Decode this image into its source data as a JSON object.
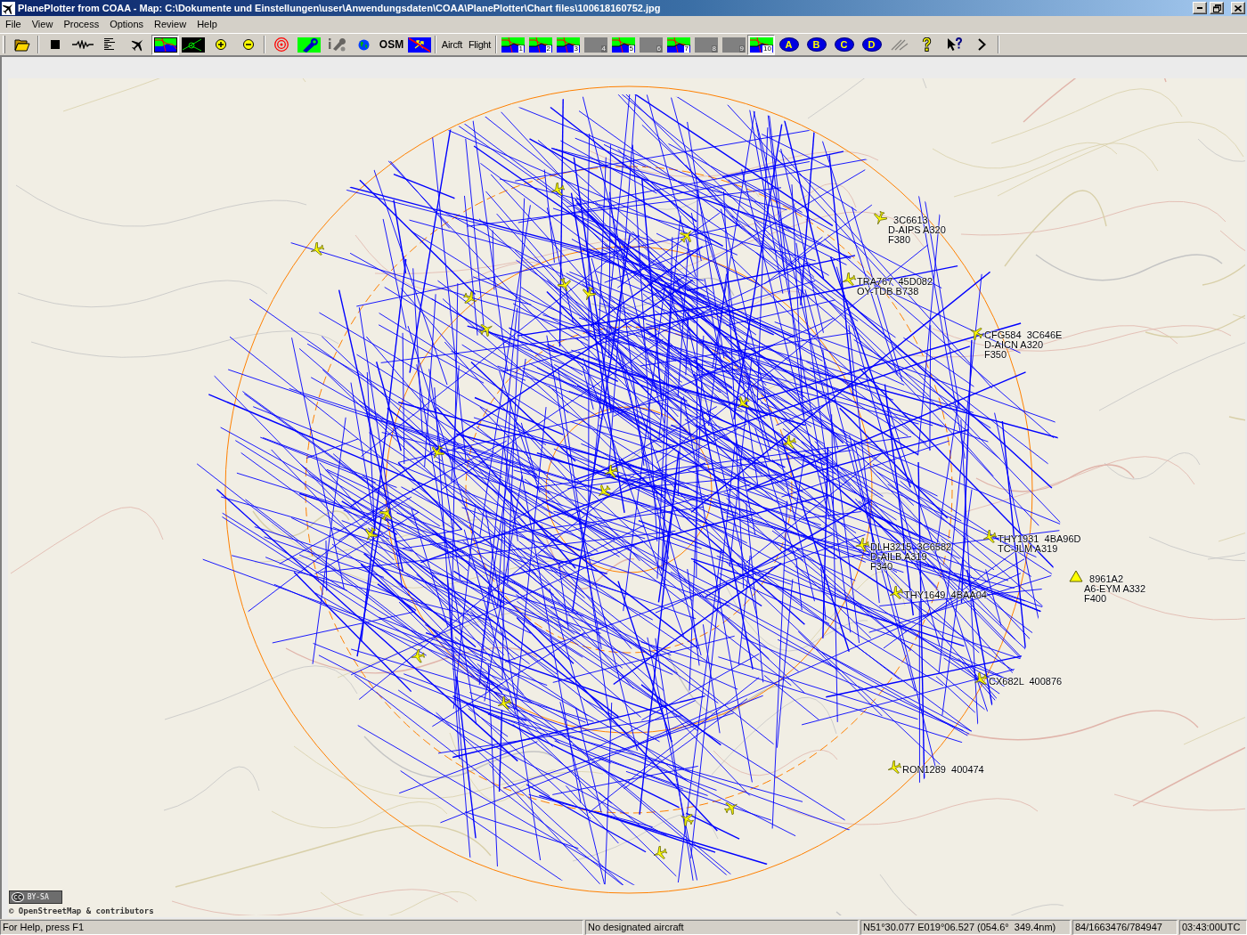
{
  "window": {
    "title": "PlanePlotter from COAA - Map: C:\\Dokumente und Einstellungen\\user\\Anwendungsdaten\\COAA\\PlanePlotter\\Chart files\\100618160752.jpg"
  },
  "menu": [
    "File",
    "View",
    "Process",
    "Options",
    "Review",
    "Help"
  ],
  "toolbar": [
    {
      "buttons": [
        {
          "kind": "open",
          "pressed": false,
          "disabled": false
        }
      ]
    },
    {
      "buttons": [
        {
          "kind": "stop",
          "pressed": false,
          "disabled": false
        },
        {
          "kind": "wave",
          "pressed": false,
          "disabled": false
        },
        {
          "kind": "list",
          "pressed": false,
          "disabled": false
        },
        {
          "kind": "plane",
          "pressed": false,
          "disabled": false
        },
        {
          "kind": "chart",
          "pressed": true,
          "disabled": false
        },
        {
          "kind": "scope",
          "pressed": false,
          "disabled": false
        },
        {
          "kind": "zoomin",
          "pressed": false,
          "disabled": false
        },
        {
          "kind": "zoomout",
          "pressed": false,
          "disabled": false
        }
      ]
    },
    {
      "buttons": [
        {
          "kind": "target",
          "pressed": false,
          "disabled": false
        },
        {
          "kind": "wrench",
          "pressed": false,
          "disabled": false
        },
        {
          "kind": "tools",
          "pressed": false,
          "disabled": true
        },
        {
          "kind": "globe",
          "pressed": false,
          "disabled": false
        },
        {
          "kind": "bold",
          "label": "OSM",
          "pressed": false,
          "disabled": false
        },
        {
          "kind": "swap",
          "pressed": false,
          "disabled": false
        }
      ]
    },
    {
      "buttons": [
        {
          "kind": "text",
          "label": "Aircft",
          "pressed": false,
          "disabled": false
        },
        {
          "kind": "text",
          "label": "Flight",
          "pressed": false,
          "disabled": false
        }
      ]
    },
    {
      "buttons": [
        {
          "kind": "slot",
          "label": "1",
          "pressed": false,
          "disabled": false
        },
        {
          "kind": "slot",
          "label": "2",
          "pressed": false,
          "disabled": false
        },
        {
          "kind": "slot",
          "label": "3",
          "pressed": false,
          "disabled": false
        },
        {
          "kind": "slot",
          "label": "4",
          "pressed": false,
          "disabled": true
        },
        {
          "kind": "slot",
          "label": "5",
          "pressed": false,
          "disabled": false
        },
        {
          "kind": "slot",
          "label": "6",
          "pressed": false,
          "disabled": true
        },
        {
          "kind": "slot",
          "label": "7",
          "pressed": false,
          "disabled": false
        },
        {
          "kind": "slot",
          "label": "8",
          "pressed": false,
          "disabled": true
        },
        {
          "kind": "slot",
          "label": "9",
          "pressed": false,
          "disabled": true
        },
        {
          "kind": "slot",
          "label": "10",
          "pressed": true,
          "disabled": false
        },
        {
          "kind": "letter",
          "label": "A",
          "pressed": false,
          "disabled": false
        },
        {
          "kind": "letter",
          "label": "B",
          "pressed": false,
          "disabled": false
        },
        {
          "kind": "letter",
          "label": "C",
          "pressed": false,
          "disabled": false
        },
        {
          "kind": "letter",
          "label": "D",
          "pressed": false,
          "disabled": false
        },
        {
          "kind": "pen",
          "pressed": false,
          "disabled": true
        },
        {
          "kind": "help",
          "pressed": false,
          "disabled": false
        },
        {
          "kind": "whatsthis",
          "pressed": false,
          "disabled": false
        },
        {
          "kind": "next",
          "pressed": false,
          "disabled": false
        }
      ]
    }
  ],
  "map": {
    "aircraft": [
      {
        "kind": "plane",
        "lines": [
          "  3C6613",
          "D-AIPS A320",
          "F380"
        ]
      },
      {
        "kind": "plane",
        "lines": [
          "TRA767  45D082",
          "OY-TDB B738"
        ]
      },
      {
        "kind": "plane",
        "lines": [
          "CFG584  3C646E",
          "D-AICN A320",
          "F350"
        ]
      },
      {
        "kind": "plane",
        "lines": [
          "THY1931  4BA96D",
          "TC-JLM A319"
        ]
      },
      {
        "kind": "plane",
        "lines": [
          "DLH3215  3C6582",
          "D-AILB A319",
          "F340"
        ]
      },
      {
        "kind": "plane",
        "lines": [
          "THY1649  4BAA04"
        ]
      },
      {
        "kind": "triangle",
        "lines": [
          "  8961A2",
          "A6-EYM A332",
          "F400"
        ]
      },
      {
        "kind": "plane",
        "lines": [
          "CX682L  400876"
        ]
      },
      {
        "kind": "plane",
        "lines": [
          "RON1289  400474"
        ]
      },
      {
        "kind": "plane"
      },
      {
        "kind": "plane"
      },
      {
        "kind": "plane"
      },
      {
        "kind": "plane"
      },
      {
        "kind": "plane"
      },
      {
        "kind": "plane"
      },
      {
        "kind": "plane"
      },
      {
        "kind": "plane"
      },
      {
        "kind": "plane"
      },
      {
        "kind": "plane"
      },
      {
        "kind": "plane"
      },
      {
        "kind": "plane"
      },
      {
        "kind": "plane"
      },
      {
        "kind": "plane"
      },
      {
        "kind": "plane"
      },
      {
        "kind": "plane"
      },
      {
        "kind": "plane"
      },
      {
        "kind": "plane"
      },
      {
        "kind": "plane"
      }
    ],
    "attribution": {
      "badge": "cc",
      "license": "BY-SA",
      "credit": "© OpenStreetMap & contributors"
    }
  },
  "status_bar": [
    "For Help, press F1",
    "No designated aircraft",
    "N51°30.077 E019°06.527 (054.6°  349.4nm)",
    "84/1663476/784947",
    "03:43:00UTC"
  ]
}
